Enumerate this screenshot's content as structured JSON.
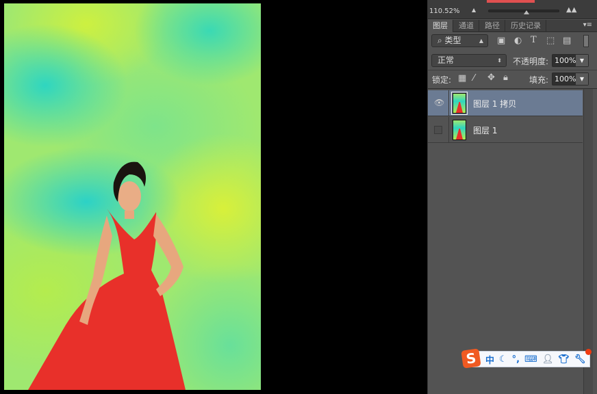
{
  "navigator": {
    "zoom": "110.52%"
  },
  "tabs": [
    {
      "label": "图层",
      "active": true
    },
    {
      "label": "通道"
    },
    {
      "label": "路径"
    },
    {
      "label": "历史记录"
    }
  ],
  "filter": {
    "kind": "类型"
  },
  "blend": {
    "mode": "正常",
    "opacity_label": "不透明度:",
    "opacity": "100%"
  },
  "lock": {
    "label": "锁定:",
    "fill_label": "填充:",
    "fill": "100%"
  },
  "layers": [
    {
      "name": "图层 1 拷贝",
      "visible": true,
      "selected": true
    },
    {
      "name": "图层 1",
      "visible": false,
      "selected": false
    }
  ],
  "ime": {
    "logo": "S",
    "mode": "中",
    "punct": "°,"
  },
  "colors": {
    "panel": "#535353",
    "selected_layer": "#6b7b93",
    "dress": "#e8302a"
  }
}
